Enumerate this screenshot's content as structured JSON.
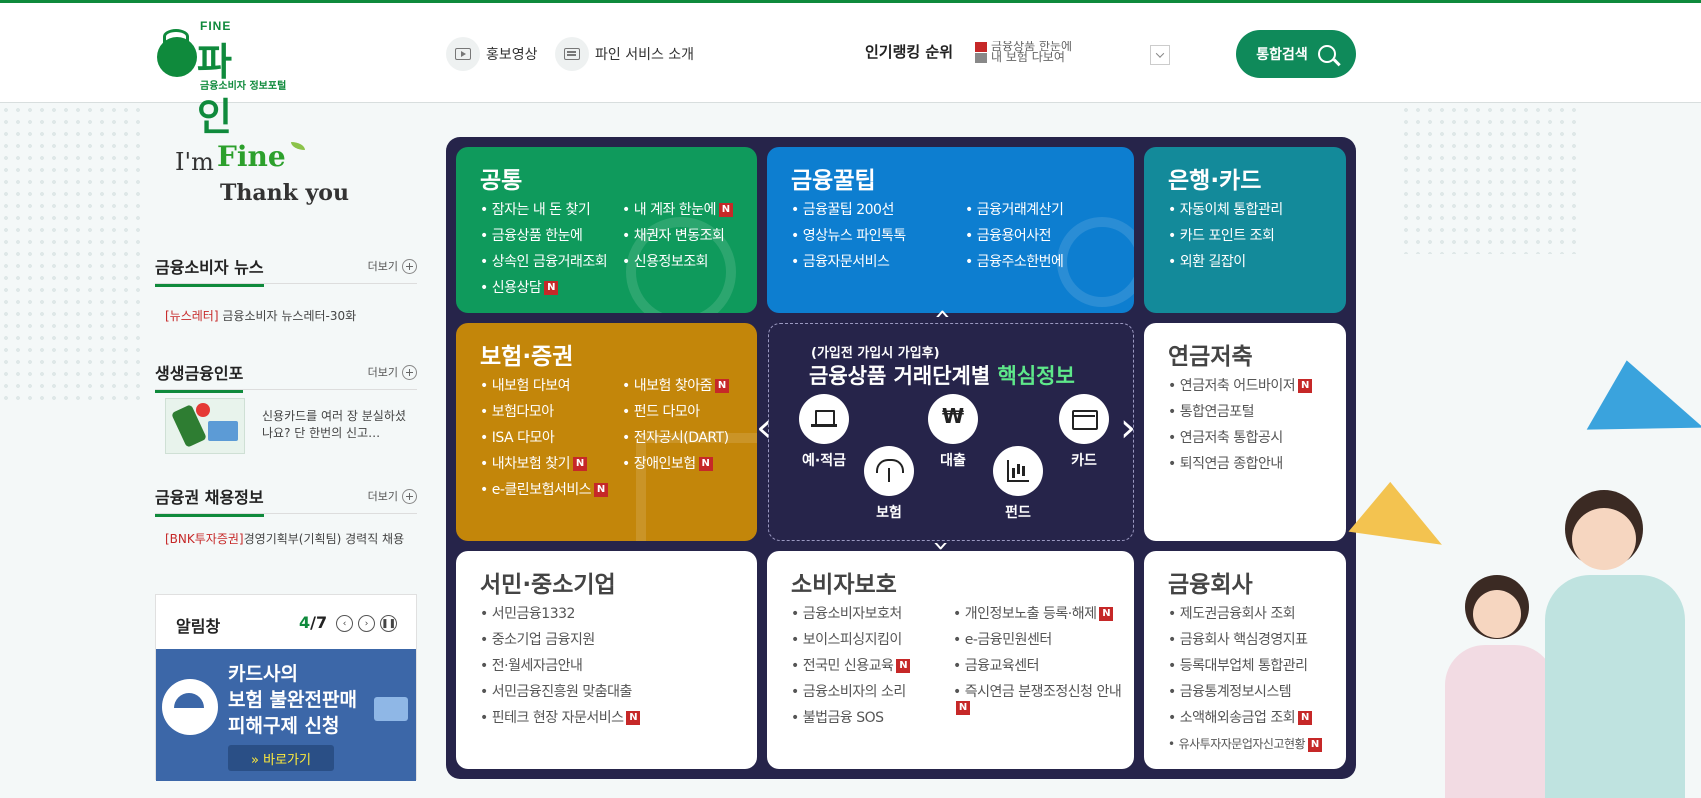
{
  "header": {
    "logo": {
      "fine": "FINE",
      "name": "파 인",
      "subtitle": "금융소비자 정보포털"
    },
    "links": [
      {
        "label": "홍보영상",
        "icon": "play-icon"
      },
      {
        "label": "파인 서비스 소개",
        "icon": "document-icon"
      }
    ],
    "ranking": {
      "title": "인기랭킹 순위",
      "items": [
        "금융상품 한눈에",
        "내 보험 다보여"
      ]
    },
    "search_label": "통합검색"
  },
  "left": {
    "slogan": {
      "im": "I'm",
      "fine": "Fine",
      "thanks": "Thank you"
    },
    "more_label": "더보기",
    "news": {
      "title": "금융소비자 뉴스",
      "items": [
        {
          "tag": "[뉴스레터]",
          "text": "금융소비자 뉴스레터-30화"
        }
      ]
    },
    "infographic": {
      "title": "생생금융인포",
      "text": "신용카드를 여러 장 분실하셨나요? 단 한번의 신고…"
    },
    "jobs": {
      "title": "금융권 채용정보",
      "items": [
        {
          "tag": "[BNK투자증권]",
          "text": "경영기획부(기획팀) 경력직 채용"
        }
      ]
    },
    "alarm": {
      "title": "알림창",
      "current": "4",
      "total": "/7",
      "banner_lines": [
        "카드사의",
        "보험 불완전판매",
        "피해구제 신청"
      ],
      "go_label": "» 바로가기"
    }
  },
  "board": {
    "common": {
      "title": "공통",
      "col1": [
        "잠자는 내 돈 찾기",
        "금융상품 한눈에",
        "상속인 금융거래조회",
        "신용상담"
      ],
      "col1_new": [
        false,
        false,
        false,
        true
      ],
      "col2": [
        "내 계좌 한눈에",
        "채권자 변동조회",
        "신용정보조회"
      ],
      "col2_new": [
        true,
        false,
        false
      ]
    },
    "tips": {
      "title": "금융꿀팁",
      "col1": [
        "금융꿀팁 200선",
        "영상뉴스 파인톡톡",
        "금융자문서비스"
      ],
      "col2": [
        "금융거래계산기",
        "금융용어사전",
        "금융주소한번에"
      ]
    },
    "bank": {
      "title": "은행·카드",
      "col1": [
        "자동이체 통합관리",
        "카드 포인트 조회",
        "외환 길잡이"
      ]
    },
    "insurance": {
      "title": "보험·증권",
      "col1": [
        "내보험 다보여",
        "보험다모아",
        "ISA 다모아",
        "내차보험 찾기",
        "e-클린보험서비스"
      ],
      "col1_new": [
        false,
        false,
        false,
        true,
        true
      ],
      "col2": [
        "내보험 찾아줌",
        "펀드 다모아",
        "전자공시(DART)",
        "장애인보험"
      ],
      "col2_new": [
        true,
        false,
        false,
        true
      ]
    },
    "core": {
      "line1": "(가입전 가입시 가입후)",
      "line2": "금융상품 거래단계별",
      "line2_highlight": "핵심정보",
      "cats": [
        "예·적금",
        "대출",
        "카드",
        "보험",
        "펀드"
      ]
    },
    "pension": {
      "title": "연금저축",
      "col1": [
        "연금저축 어드바이저",
        "통합연금포털",
        "연금저축 통합공시",
        "퇴직연금 종합안내"
      ],
      "col1_new": [
        true,
        false,
        false,
        false
      ]
    },
    "sme": {
      "title": "서민·중소기업",
      "col1": [
        "서민금융1332",
        "중소기업 금융지원",
        "전·월세자금안내",
        "서민금융진흥원 맞춤대출",
        "핀테크 현장 자문서비스"
      ],
      "col1_new": [
        false,
        false,
        false,
        false,
        true
      ]
    },
    "consumer": {
      "title": "소비자보호",
      "col1": [
        "금융소비자보호처",
        "보이스피싱지킴이",
        "전국민 신용교육",
        "금융소비자의 소리",
        "불법금융 SOS"
      ],
      "col1_new": [
        false,
        false,
        true,
        false,
        false
      ],
      "col2": [
        "개인정보노출 등록·해제",
        "e-금융민원센터",
        "금융교육센터",
        "즉시연금 분쟁조정신청 안내"
      ],
      "col2_new": [
        true,
        false,
        false,
        true
      ]
    },
    "company": {
      "title": "금융회사",
      "col1": [
        "제도권금융회사 조회",
        "금융회사 핵심경영지표",
        "등록대부업체 통합관리",
        "금융통계정보시스템",
        "소액해외송금업 조회",
        "유사투자자문업자신고현황"
      ],
      "col1_new": [
        false,
        false,
        false,
        false,
        true,
        true
      ]
    }
  },
  "colors": {
    "brand": "#0f8a3c",
    "common": "#0f9a5c",
    "tips": "#0d7ed0",
    "bank": "#138a9a",
    "insurance": "#c3860a",
    "board": "#26244a",
    "new_badge": "#c62828"
  },
  "new_badge": "N"
}
